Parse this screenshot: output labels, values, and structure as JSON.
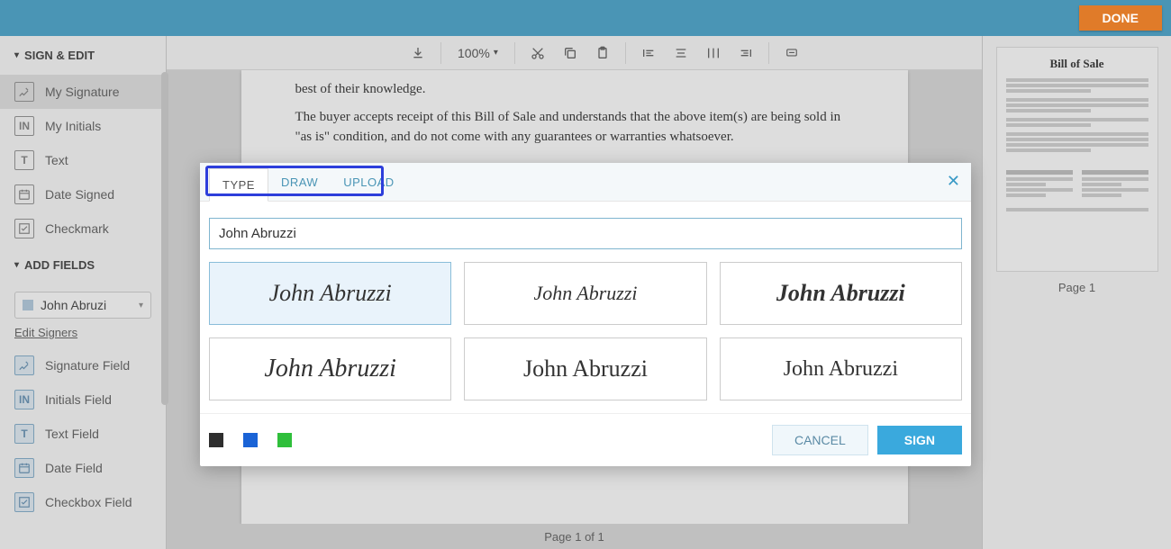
{
  "topbar": {
    "done": "DONE"
  },
  "sidebar": {
    "sections": {
      "sign_edit": "SIGN & EDIT",
      "add_fields": "ADD FIELDS"
    },
    "items": {
      "my_signature": "My Signature",
      "my_initials": "My Initials",
      "text": "Text",
      "date_signed": "Date Signed",
      "checkmark": "Checkmark",
      "signature_field": "Signature Field",
      "initials_field": "Initials Field",
      "text_field": "Text Field",
      "date_field": "Date Field",
      "checkbox_field": "Checkbox Field"
    },
    "signer": "John Abruzi",
    "edit_signers": "Edit Signers"
  },
  "toolbar": {
    "zoom": "100%"
  },
  "document": {
    "line1": "best of their knowledge.",
    "line2": "The buyer accepts receipt of this Bill of Sale and understands that the above item(s) are being sold in \"as is\" condition, and do not come with any guarantees or warranties whatsoever."
  },
  "footer": {
    "page_of": "Page 1 of 1"
  },
  "rightpanel": {
    "thumb_title": "Bill of Sale",
    "caption": "Page 1"
  },
  "modal": {
    "tabs": {
      "type": "TYPE",
      "draw": "DRAW",
      "upload": "UPLOAD"
    },
    "input_value": "John Abruzzi",
    "sig_text": "John Abruzzi",
    "colors": {
      "black": "#2e2e2e",
      "blue": "#1a63d6",
      "green": "#2fbf3b"
    },
    "cancel": "CANCEL",
    "sign": "SIGN"
  }
}
